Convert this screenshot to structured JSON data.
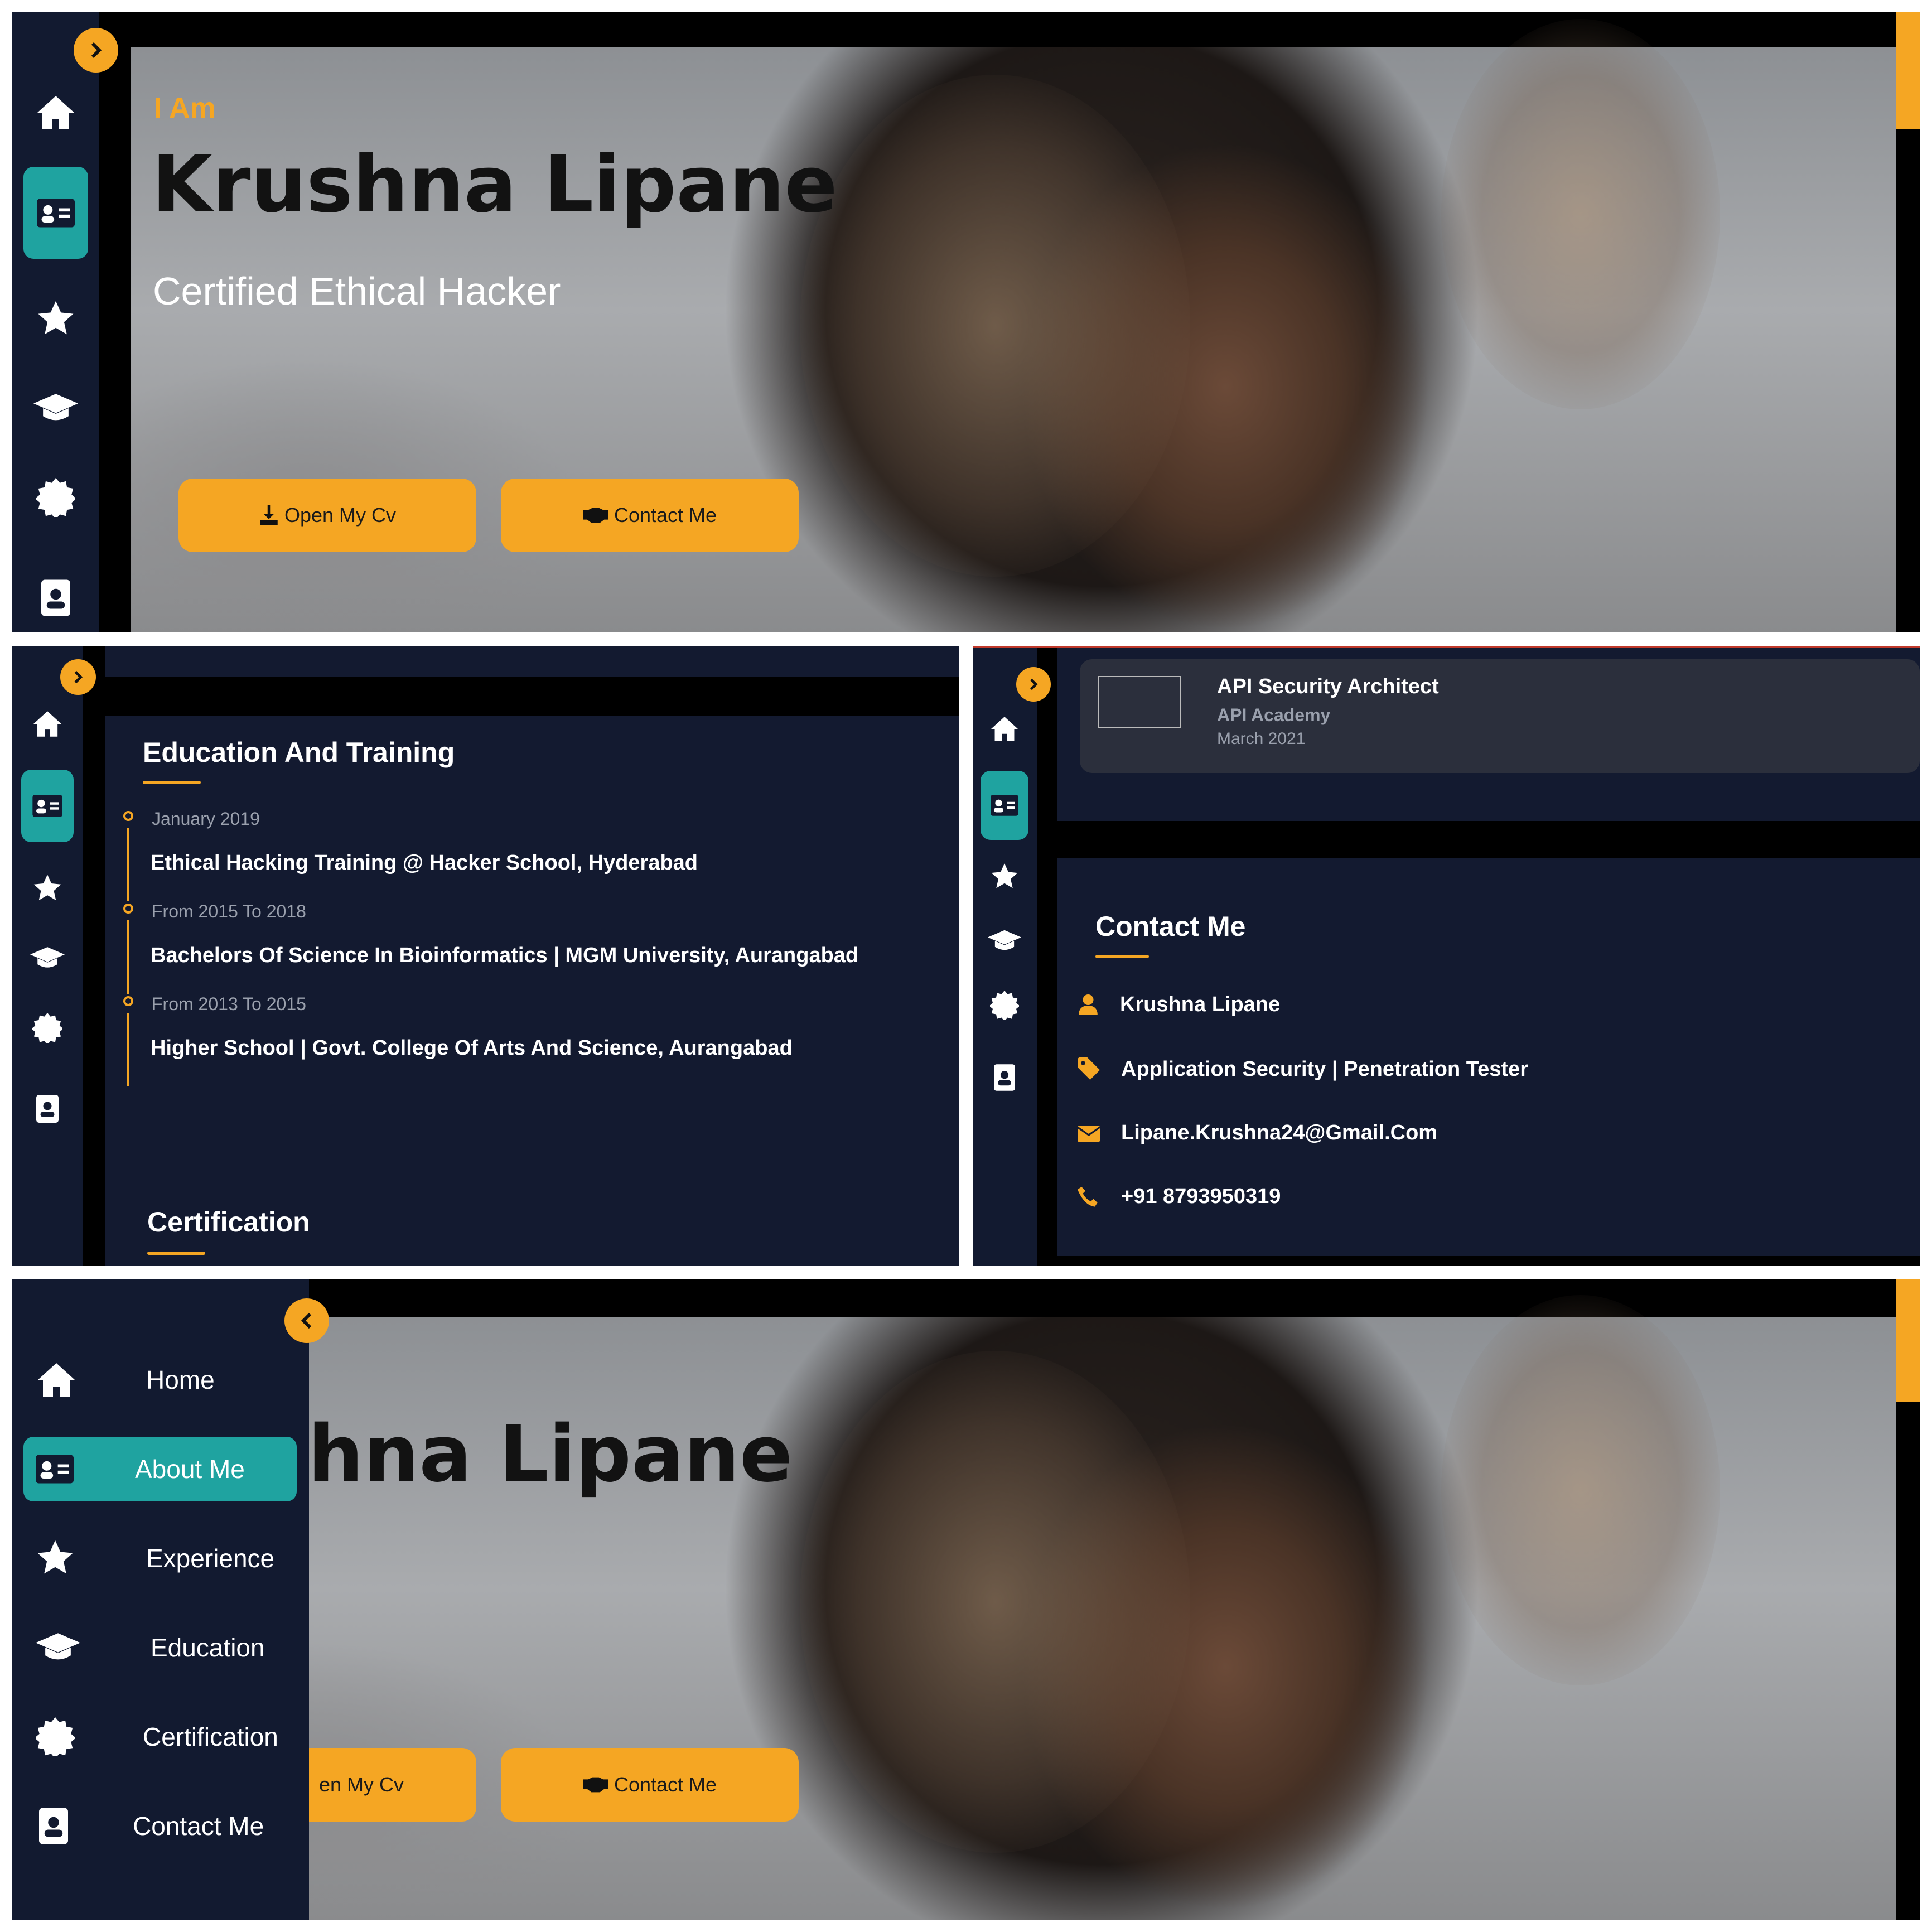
{
  "hero": {
    "intro": "I Am",
    "name": "Krushna Lipane",
    "subtitle": "Certified Ethical Hacker",
    "buttons": {
      "cv": "Open My Cv",
      "contact": "Contact Me",
      "cv_partial": "en My Cv"
    },
    "name_partial": "hna Lipane"
  },
  "sidebar": {
    "items": [
      {
        "label": "Home",
        "icon": "home-icon"
      },
      {
        "label": "About Me",
        "icon": "id-card-icon"
      },
      {
        "label": "Experience",
        "icon": "star-icon"
      },
      {
        "label": "Education",
        "icon": "graduation-cap-icon"
      },
      {
        "label": "Certification",
        "icon": "certificate-icon"
      },
      {
        "label": "Contact Me",
        "icon": "contact-book-icon"
      }
    ]
  },
  "education": {
    "title": "Education And Training",
    "entries": [
      {
        "date": "January 2019",
        "title": "Ethical Hacking Training @ Hacker School, Hyderabad"
      },
      {
        "date": "From 2015 To 2018",
        "title": "Bachelors Of Science In Bioinformatics | MGM University, Aurangabad"
      },
      {
        "date": "From 2013 To 2015",
        "title": "Higher School | Govt. College Of Arts And Science, Aurangabad"
      }
    ]
  },
  "certification": {
    "title": "Certification",
    "card": {
      "title": "API Security Architect",
      "issuer": "API Academy",
      "date": "March 2021"
    }
  },
  "contact": {
    "title": "Contact Me",
    "name": "Krushna Lipane",
    "role": "Application Security | Penetration Tester",
    "email": "Lipane.Krushna24@Gmail.Com",
    "phone": "+91 8793950319"
  },
  "colors": {
    "accent": "#f5a623",
    "active": "#1fa3a0",
    "panel": "#131a30"
  }
}
